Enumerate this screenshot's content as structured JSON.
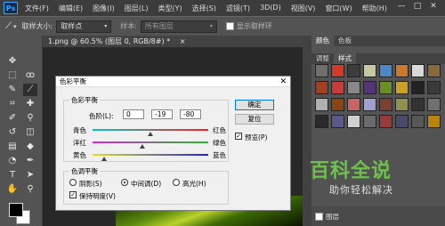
{
  "menubar": {
    "logo": "Ps",
    "items": [
      "文件(F)",
      "编辑(E)",
      "图像(I)",
      "图层(L)",
      "类型(Y)",
      "选择(S)",
      "滤镜(T)",
      "3D(D)",
      "视图(V)",
      "窗口(W)",
      "帮助(H)"
    ],
    "controls": [
      "—",
      "□",
      "✕"
    ]
  },
  "options": {
    "size_label": "取样大小:",
    "size_value": "取样点",
    "sample_label": "样本:",
    "sample_value": "所有图层",
    "show_ring": "显示取样环"
  },
  "document": {
    "tab_title": "1.png @ 60.5% (图层 0, RGB/8#) *",
    "tab_close": "×"
  },
  "panel": {
    "tabs_row1": [
      "颜色",
      "色板"
    ],
    "tabs_row2": [
      "调整",
      "样式"
    ],
    "bottom_check": "图层",
    "style_colors": [
      "#6e6e6e",
      "#d43a2a",
      "#3d3d3d",
      "#c8c8a0",
      "#4a88c9",
      "#cc7a2a",
      "#d9d9d9",
      "#8a6a3a",
      "#a04020",
      "#c83c3c",
      "#888888",
      "#553377",
      "#6b8e23",
      "#c9a227",
      "#222222",
      "#3a3a3a",
      "#b0b0b0",
      "#8b4513",
      "#c86464",
      "#a0a0d0",
      "#7a4030",
      "#909050",
      "#333333",
      "#707070",
      "#2a2a2a",
      "#5a5a8a",
      "#d0d0d0",
      "#6a6a6a",
      "#9a3a3a",
      "#4a4a6a",
      "#585858",
      "#b8860b"
    ]
  },
  "watermark": {
    "title": "百科全说",
    "subtitle": "助你轻松解决"
  },
  "dialog": {
    "title": "色彩平衡",
    "close": "✕",
    "balance_group": "色彩平衡",
    "levels_label": "色阶(L):",
    "levels": [
      "0",
      "-19",
      "-80"
    ],
    "sliders": [
      {
        "left": "青色",
        "right": "红色",
        "position": 0.5,
        "color": "linear-gradient(90deg,#00c8c8,#ff2020)"
      },
      {
        "left": "洋红",
        "right": "绿色",
        "position": 0.43,
        "color": "linear-gradient(90deg,#e020e0,#20c020)"
      },
      {
        "left": "黄色",
        "right": "蓝色",
        "position": 0.1,
        "color": "linear-gradient(90deg,#e0e020,#2020e0)"
      }
    ],
    "tone_group": "色调平衡",
    "tone_options": [
      "阴影(S)",
      "中间调(D)",
      "高光(H)"
    ],
    "tone_selected": 1,
    "preserve": "保持明度(V)",
    "preserve_checked": "✓",
    "ok": "确定",
    "reset": "复位",
    "preview": "预览(P)",
    "preview_checked": "✓"
  }
}
